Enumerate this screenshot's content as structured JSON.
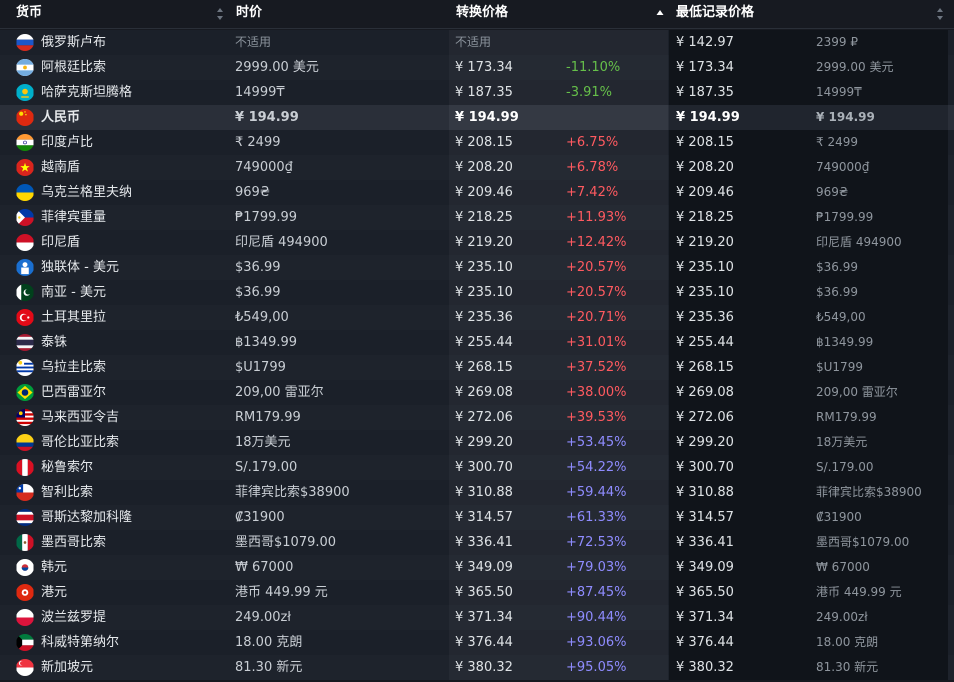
{
  "header": {
    "currency": "货币",
    "price": "时价",
    "converted": "转换价格",
    "lowest": "最低记录价格"
  },
  "rows": [
    {
      "name": "俄罗斯卢布",
      "flag": "ru",
      "price": "不适用",
      "conv": "不适用",
      "pct": "",
      "low": "¥ 142.97",
      "lowp": "2399 ₽"
    },
    {
      "name": "阿根廷比索",
      "flag": "ar",
      "price": "2999.00 美元",
      "conv": "¥ 173.34",
      "pct": "-11.10%",
      "low": "¥ 173.34",
      "lowp": "2999.00 美元"
    },
    {
      "name": "哈萨克斯坦腾格",
      "flag": "kz",
      "price": "14999₸",
      "conv": "¥ 187.35",
      "pct": "-3.91%",
      "low": "¥ 187.35",
      "lowp": "14999₸"
    },
    {
      "name": "人民币",
      "flag": "cn",
      "price": "¥ 194.99",
      "conv": "¥ 194.99",
      "pct": "",
      "low": "¥ 194.99",
      "lowp": "¥ 194.99",
      "highlight": true
    },
    {
      "name": "印度卢比",
      "flag": "in",
      "price": "₹ 2499",
      "conv": "¥ 208.15",
      "pct": "+6.75%",
      "low": "¥ 208.15",
      "lowp": "₹ 2499"
    },
    {
      "name": "越南盾",
      "flag": "vn",
      "price": "749000₫",
      "conv": "¥ 208.20",
      "pct": "+6.78%",
      "low": "¥ 208.20",
      "lowp": "749000₫"
    },
    {
      "name": "乌克兰格里夫纳",
      "flag": "ua",
      "price": "969₴",
      "conv": "¥ 209.46",
      "pct": "+7.42%",
      "low": "¥ 209.46",
      "lowp": "969₴"
    },
    {
      "name": "菲律宾重量",
      "flag": "ph",
      "price": "₱1799.99",
      "conv": "¥ 218.25",
      "pct": "+11.93%",
      "low": "¥ 218.25",
      "lowp": "₱1799.99"
    },
    {
      "name": "印尼盾",
      "flag": "id",
      "price": "印尼盾 494900",
      "conv": "¥ 219.20",
      "pct": "+12.42%",
      "low": "¥ 219.20",
      "lowp": "印尼盾 494900"
    },
    {
      "name": "独联体 - 美元",
      "flag": "cis",
      "price": "$36.99",
      "conv": "¥ 235.10",
      "pct": "+20.57%",
      "low": "¥ 235.10",
      "lowp": "$36.99"
    },
    {
      "name": "南亚 - 美元",
      "flag": "sa",
      "price": "$36.99",
      "conv": "¥ 235.10",
      "pct": "+20.57%",
      "low": "¥ 235.10",
      "lowp": "$36.99"
    },
    {
      "name": "土耳其里拉",
      "flag": "tr",
      "price": "₺549,00",
      "conv": "¥ 235.36",
      "pct": "+20.71%",
      "low": "¥ 235.36",
      "lowp": "₺549,00"
    },
    {
      "name": "泰铢",
      "flag": "th",
      "price": "฿1349.99",
      "conv": "¥ 255.44",
      "pct": "+31.01%",
      "low": "¥ 255.44",
      "lowp": "฿1349.99"
    },
    {
      "name": "乌拉圭比索",
      "flag": "uy",
      "price": "$U1799",
      "conv": "¥ 268.15",
      "pct": "+37.52%",
      "low": "¥ 268.15",
      "lowp": "$U1799"
    },
    {
      "name": "巴西雷亚尔",
      "flag": "br",
      "price": "209,00 雷亚尔",
      "conv": "¥ 269.08",
      "pct": "+38.00%",
      "low": "¥ 269.08",
      "lowp": "209,00 雷亚尔"
    },
    {
      "name": "马来西亚令吉",
      "flag": "my",
      "price": "RM179.99",
      "conv": "¥ 272.06",
      "pct": "+39.53%",
      "low": "¥ 272.06",
      "lowp": "RM179.99"
    },
    {
      "name": "哥伦比亚比索",
      "flag": "co",
      "price": "18万美元",
      "conv": "¥ 299.20",
      "pct": "+53.45%",
      "low": "¥ 299.20",
      "lowp": "18万美元"
    },
    {
      "name": "秘鲁索尔",
      "flag": "pe",
      "price": "S/.179.00",
      "conv": "¥ 300.70",
      "pct": "+54.22%",
      "low": "¥ 300.70",
      "lowp": "S/.179.00"
    },
    {
      "name": "智利比索",
      "flag": "cl",
      "price": "菲律宾比索$38900",
      "conv": "¥ 310.88",
      "pct": "+59.44%",
      "low": "¥ 310.88",
      "lowp": "菲律宾比索$38900"
    },
    {
      "name": "哥斯达黎加科隆",
      "flag": "cr",
      "price": "₡31900",
      "conv": "¥ 314.57",
      "pct": "+61.33%",
      "low": "¥ 314.57",
      "lowp": "₡31900"
    },
    {
      "name": "墨西哥比索",
      "flag": "mx",
      "price": "墨西哥$1079.00",
      "conv": "¥ 336.41",
      "pct": "+72.53%",
      "low": "¥ 336.41",
      "lowp": "墨西哥$1079.00"
    },
    {
      "name": "韩元",
      "flag": "kr",
      "price": "₩ 67000",
      "conv": "¥ 349.09",
      "pct": "+79.03%",
      "low": "¥ 349.09",
      "lowp": "₩ 67000"
    },
    {
      "name": "港元",
      "flag": "hk",
      "price": "港币 449.99 元",
      "conv": "¥ 365.50",
      "pct": "+87.45%",
      "low": "¥ 365.50",
      "lowp": "港币 449.99 元"
    },
    {
      "name": "波兰兹罗提",
      "flag": "pl",
      "price": "249.00zł",
      "conv": "¥ 371.34",
      "pct": "+90.44%",
      "low": "¥ 371.34",
      "lowp": "249.00zł"
    },
    {
      "name": "科威特第纳尔",
      "flag": "kw",
      "price": "18.00 克朗",
      "conv": "¥ 376.44",
      "pct": "+93.06%",
      "low": "¥ 376.44",
      "lowp": "18.00 克朗"
    },
    {
      "name": "新加坡元",
      "flag": "sg",
      "price": "81.30 新元",
      "conv": "¥ 380.32",
      "pct": "+95.05%",
      "low": "¥ 380.32",
      "lowp": "81.30 新元"
    }
  ]
}
